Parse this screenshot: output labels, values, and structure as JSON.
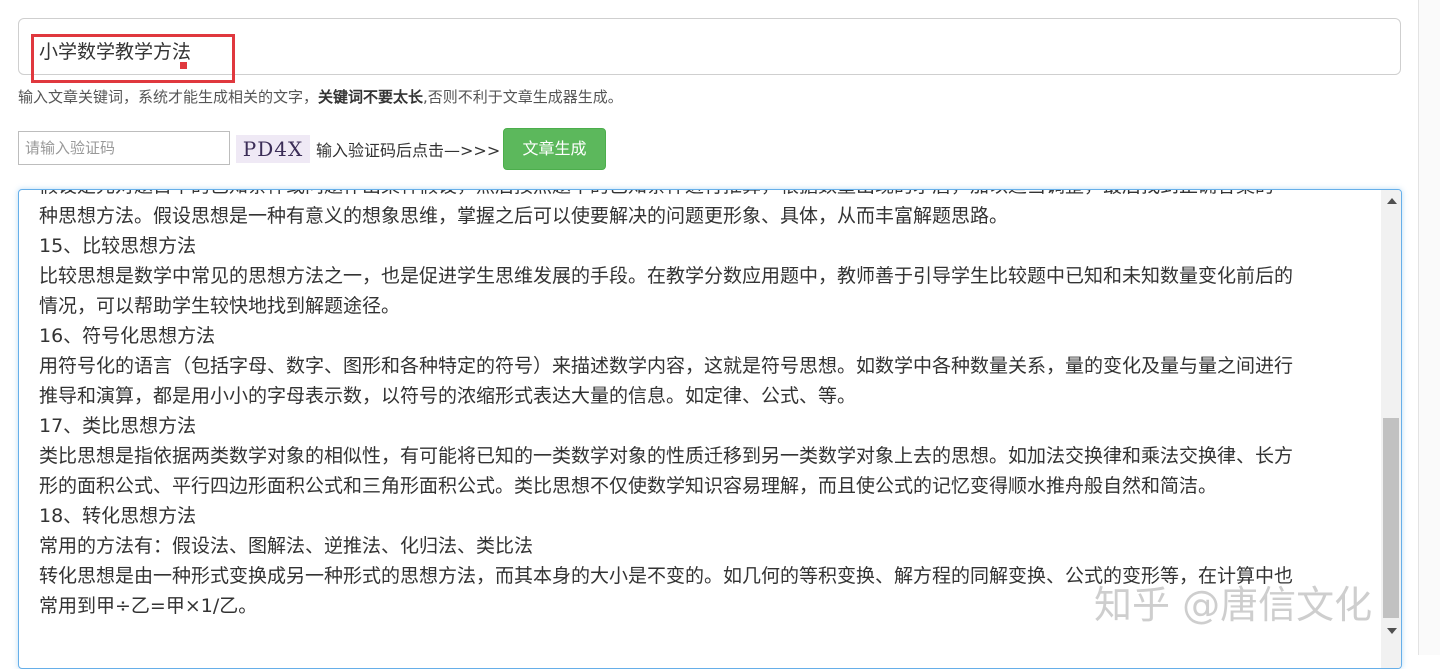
{
  "keyword": {
    "value": "小学数学教学方法"
  },
  "hint": {
    "before": "输入文章关键词，系统才能生成相关的文字，",
    "bold": "关键词不要太长",
    "after": ",否则不利于文章生成器生成。"
  },
  "captcha": {
    "placeholder": "请输入验证码",
    "image_text": "PD4X",
    "label": "输入验证码后点击—>>>"
  },
  "generate_button": "文章生成",
  "output": {
    "lines": [
      "假设是先对题目中的已知条件或问题作出某种假设，然后按照题中的已知条件进行推算，根据数量出现的矛盾，加以适当调整，最后找到正确答案的一",
      "种思想方法。假设思想是一种有意义的想象思维，掌握之后可以使要解决的问题更形象、具体，从而丰富解题思路。",
      "15、比较思想方法",
      "比较思想是数学中常见的思想方法之一，也是促进学生思维发展的手段。在教学分数应用题中，教师善于引导学生比较题中已知和未知数量变化前后的",
      "情况，可以帮助学生较快地找到解题途径。",
      "16、符号化思想方法",
      "用符号化的语言（包括字母、数字、图形和各种特定的符号）来描述数学内容，这就是符号思想。如数学中各种数量关系，量的变化及量与量之间进行",
      "推导和演算，都是用小小的字母表示数，以符号的浓缩形式表达大量的信息。如定律、公式、等。",
      "17、类比思想方法",
      "类比思想是指依据两类数学对象的相似性，有可能将已知的一类数学对象的性质迁移到另一类数学对象上去的思想。如加法交换律和乘法交换律、长方",
      "形的面积公式、平行四边形面积公式和三角形面积公式。类比思想不仅使数学知识容易理解，而且使公式的记忆变得顺水推舟般自然和简洁。",
      "18、转化思想方法",
      "常用的方法有：假设法、图解法、逆推法、化归法、类比法",
      "转化思想是由一种形式变换成另一种形式的思想方法，而其本身的大小是不变的。如几何的等积变换、解方程的同解变换、公式的变形等，在计算中也",
      "常用到甲÷乙=甲×1/乙。"
    ]
  },
  "watermark": "知乎 @唐信文化",
  "colors": {
    "button_green": "#5cb85c",
    "focus_border": "#66afe9",
    "annotation_red": "#e0383e"
  }
}
